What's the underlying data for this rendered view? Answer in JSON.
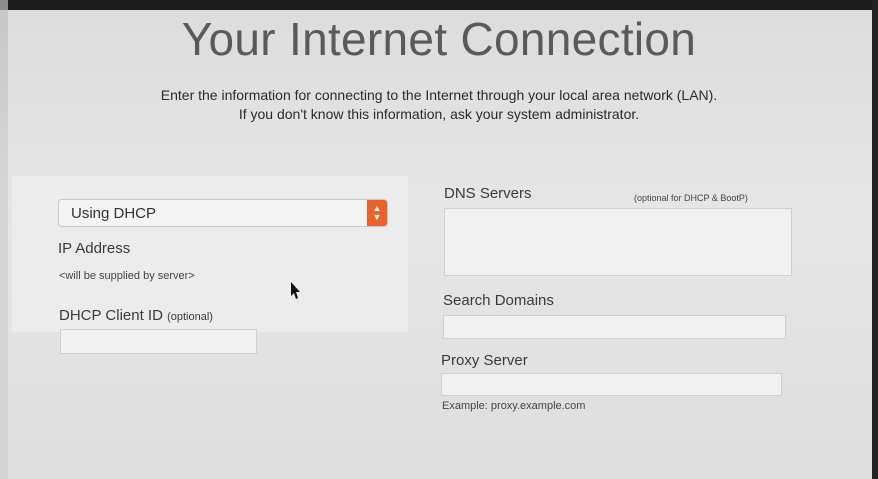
{
  "header": {
    "title": "Your Internet Connection",
    "subtitle_line1": "Enter the information for connecting to the Internet through your local area network (LAN).",
    "subtitle_line2": "If you don't know this information, ask your system administrator."
  },
  "left": {
    "config_method": "Using DHCP",
    "ip_label": "IP Address",
    "ip_value": "<will be supplied by server>",
    "dhcp_label": "DHCP Client ID",
    "dhcp_optional": "(optional)",
    "dhcp_value": ""
  },
  "right": {
    "dns_label": "DNS Servers",
    "dns_note": "(optional for DHCP & BootP)",
    "dns_value": "",
    "search_label": "Search Domains",
    "search_value": "",
    "proxy_label": "Proxy Server",
    "proxy_value": "",
    "proxy_example": "Example: proxy.example.com"
  },
  "colors": {
    "popup_accent": "#e9622a"
  },
  "icons": {
    "popup_arrows": "updown-chevron-icon",
    "cursor": "mouse-pointer-icon"
  }
}
